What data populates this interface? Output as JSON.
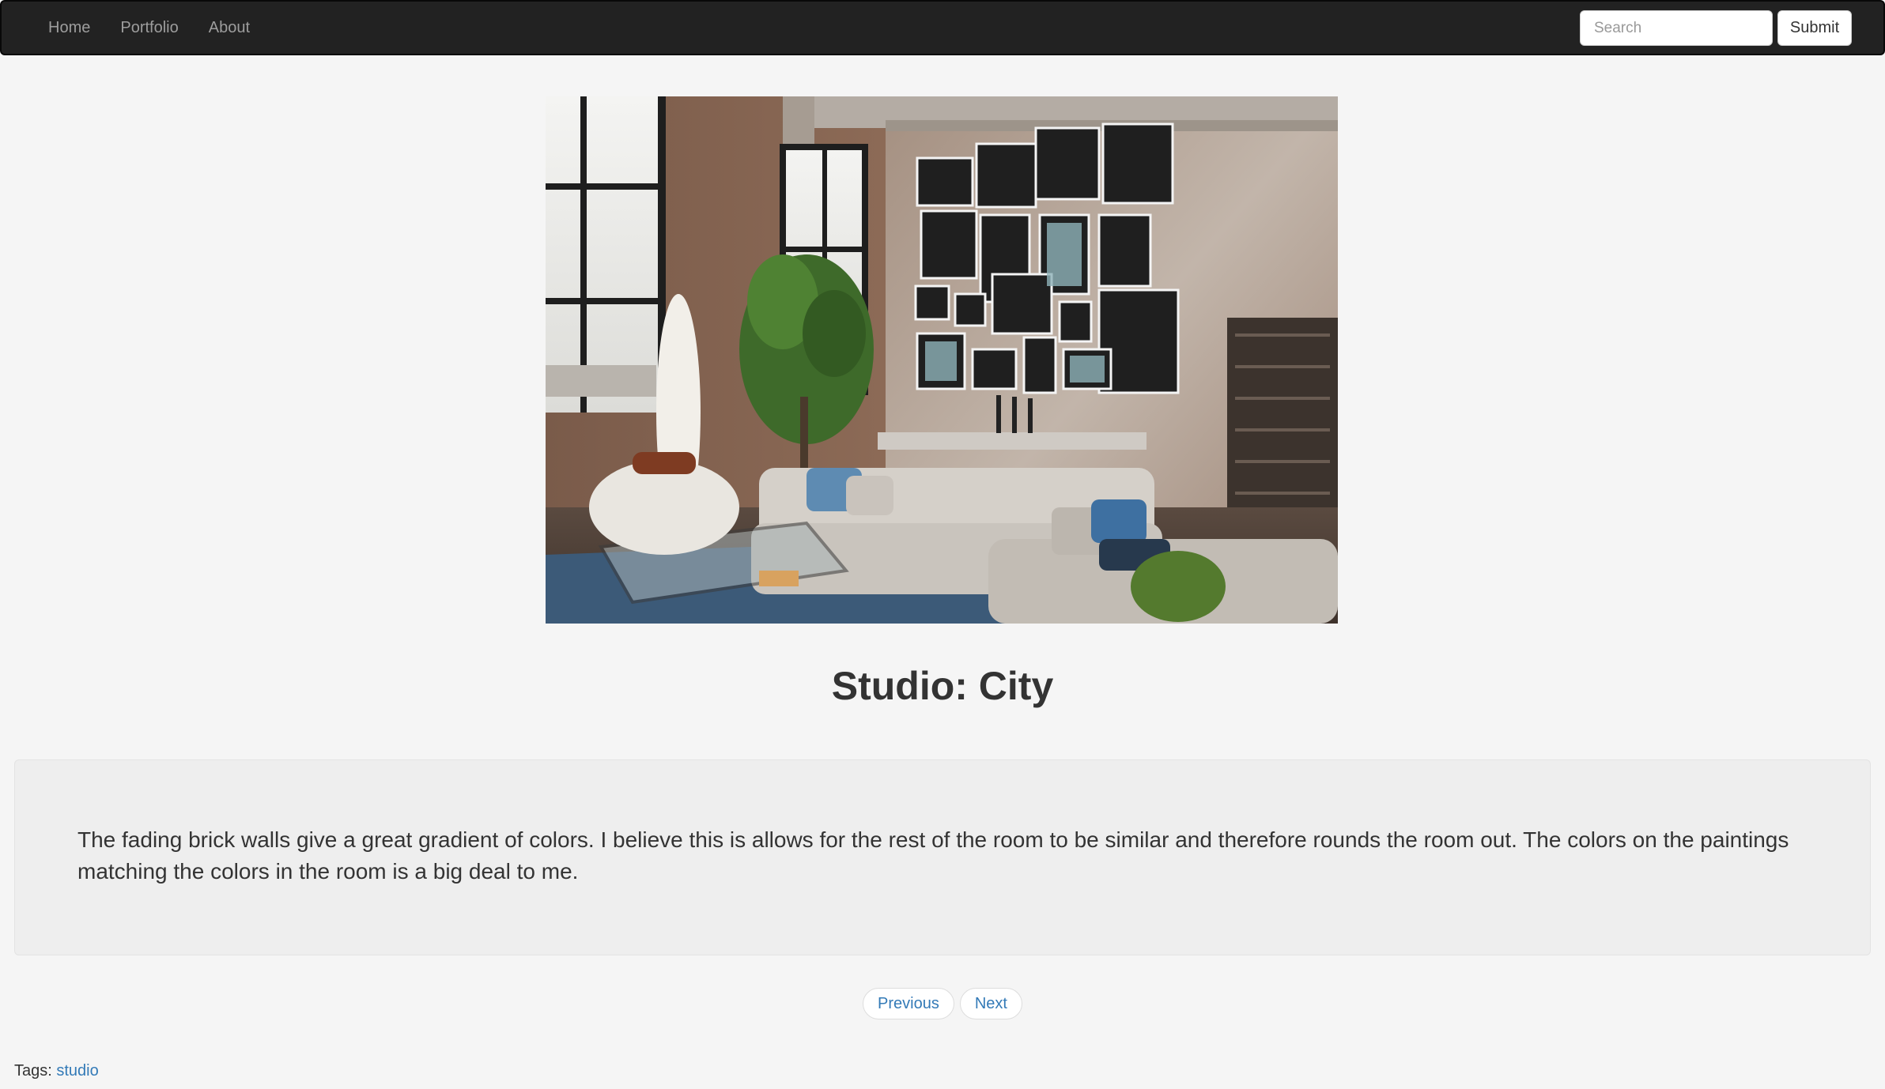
{
  "navbar": {
    "links": [
      {
        "label": "Home"
      },
      {
        "label": "Portfolio"
      },
      {
        "label": "About"
      }
    ],
    "search": {
      "placeholder": "Search",
      "submit_label": "Submit"
    }
  },
  "post": {
    "title": "Studio: City",
    "description": "The fading brick walls give a great gradient of colors. I believe this is allows for the rest of the room to be similar and therefore rounds the room out. The colors on the paintings matching the colors in the room is a big deal to me."
  },
  "pager": {
    "previous_label": "Previous",
    "next_label": "Next"
  },
  "tags": {
    "prefix": "Tags:",
    "items": [
      {
        "label": "studio"
      }
    ]
  },
  "colors": {
    "navbar_bg": "#222222",
    "page_bg": "#f5f5f5",
    "well_bg": "#eeeeee",
    "link": "#337ab7"
  }
}
